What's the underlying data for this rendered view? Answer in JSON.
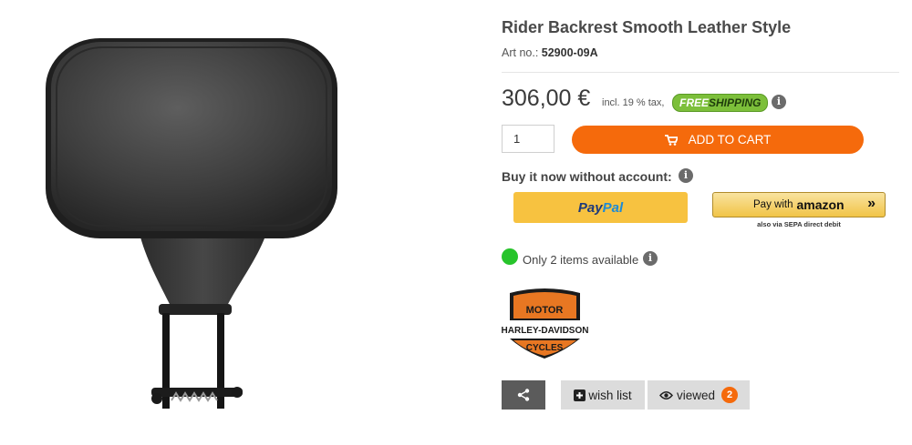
{
  "product": {
    "title": "Rider Backrest Smooth Leather Style",
    "art_label": "Art no.:",
    "art_number": "52900-09A",
    "price": "306,00 €",
    "tax_note": "incl. 19 % tax,",
    "free_label": "FREE",
    "shipping_label": "SHIPPING"
  },
  "purchase": {
    "quantity": "1",
    "add_to_cart_label": "ADD TO CART",
    "buy_without_account_label": "Buy it now without account:",
    "paypal_pay": "Pay",
    "paypal_pal": "Pal",
    "amazon_pay_with": "Pay with",
    "amazon_brand": "amazon",
    "amazon_subtext": "also via SEPA direct debit"
  },
  "stock": {
    "text": "Only 2 items available",
    "status_color": "#27c42b"
  },
  "brand": {
    "name_top": "MOTOR",
    "name_main": "HARLEY-DAVIDSON",
    "name_bottom": "CYCLES"
  },
  "actions": {
    "wishlist_label": "wish list",
    "viewed_label": "viewed",
    "viewed_count": "2"
  },
  "colors": {
    "accent": "#f56a0c",
    "freeship_green": "#7cbf3a",
    "paypal_yellow": "#f7c240"
  },
  "icons": {
    "cart": "cart-icon",
    "info": "info-icon",
    "share": "share-icon",
    "wishlist": "plus-square-icon",
    "viewed": "eye-icon"
  }
}
